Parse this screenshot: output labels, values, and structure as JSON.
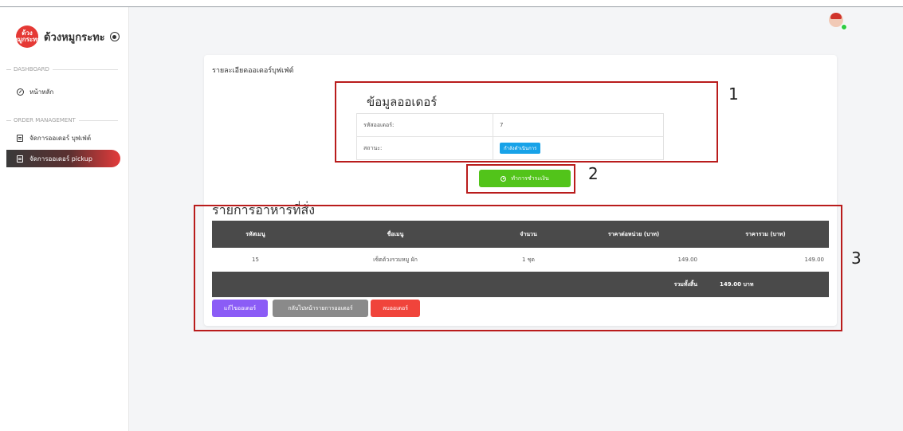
{
  "brand": {
    "logo_text": "ด้วง\nหมูกระทะ",
    "name": "ด้วงหมูกระทะ"
  },
  "sidebar": {
    "sections": [
      {
        "label": "DASHBOARD",
        "items": [
          {
            "label": "หน้าหลัก",
            "icon": "dashboard-icon",
            "active": false
          }
        ]
      },
      {
        "label": "ORDER MANAGEMENT",
        "items": [
          {
            "label": "จัดการออเดอร์ บุฟเฟ่ต์",
            "icon": "document-icon",
            "active": false
          },
          {
            "label": "จัดการออเดอร์ pickup",
            "icon": "document-icon",
            "active": true
          }
        ]
      }
    ]
  },
  "page": {
    "title": "รายละเอียดออเดอร์บุฟเฟ่ต์"
  },
  "order_info": {
    "heading": "ข้อมูลออเดอร์",
    "rows": [
      {
        "key": "รหัสออเดอร์:",
        "value": "7"
      },
      {
        "key": "สถานะ:",
        "value": "กำลังดำเนินการ"
      }
    ]
  },
  "pay_button": {
    "label": "ทำการชำระเงิน"
  },
  "food_list": {
    "heading": "รายการอาหารที่สั่ง",
    "columns": [
      "รหัสเมนู",
      "ชื่อเมนู",
      "จำนวน",
      "ราคาต่อหน่วย (บาท)",
      "ราคารวม (บาท)"
    ],
    "rows": [
      {
        "code": "15",
        "name": "เซ็ตด้วงรวมหมู ผัก",
        "qty": "1 ชุด",
        "unit_price": "149.00",
        "total": "149.00"
      }
    ],
    "total_label": "รวมทั้งสิ้น",
    "total_value": "149.00 บาท"
  },
  "actions": {
    "edit": "แก้ไขออเดอร์",
    "back": "กลับไปหน้ารายการออเดอร์",
    "delete": "ลบออเดอร์"
  },
  "annotations": [
    "1",
    "2",
    "3"
  ],
  "colors": {
    "accent_red": "#e43b3b",
    "status_blue": "#17a2e8",
    "pay_green": "#52c41a",
    "edit_purple": "#8b5cf6",
    "delete_red": "#f0443b"
  }
}
